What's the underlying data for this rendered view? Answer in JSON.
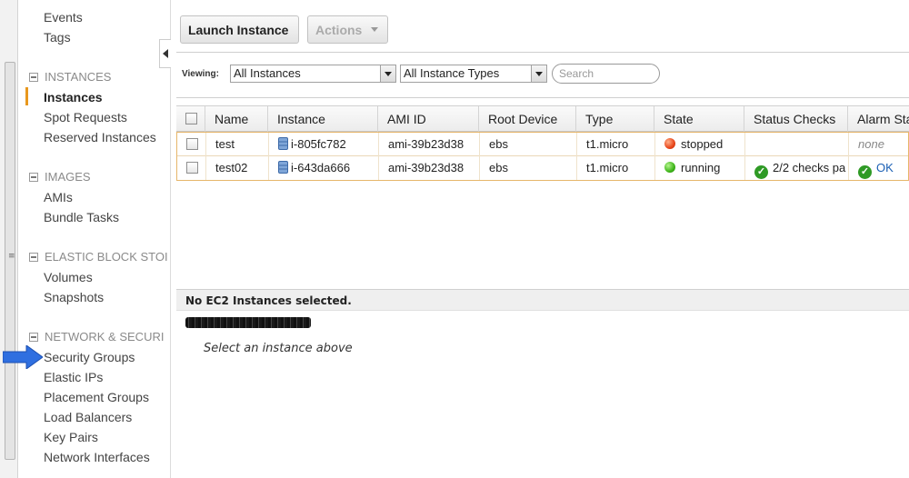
{
  "sidebar": {
    "top_items": [
      "Events",
      "Tags"
    ],
    "sections": [
      {
        "title": "INSTANCES",
        "items": [
          "Instances",
          "Spot Requests",
          "Reserved Instances"
        ]
      },
      {
        "title": "IMAGES",
        "items": [
          "AMIs",
          "Bundle Tasks"
        ]
      },
      {
        "title": "ELASTIC BLOCK STOI",
        "items": [
          "Volumes",
          "Snapshots"
        ]
      },
      {
        "title": "NETWORK & SECURI",
        "items": [
          "Security Groups",
          "Elastic IPs",
          "Placement Groups",
          "Load Balancers",
          "Key Pairs",
          "Network Interfaces"
        ]
      }
    ],
    "active_item": "Instances"
  },
  "toolbar": {
    "launch_label": "Launch Instance",
    "actions_label": "Actions"
  },
  "filters": {
    "viewing_label": "Viewing:",
    "instances_filter": "All Instances",
    "types_filter": "All Instance Types",
    "search_placeholder": "Search"
  },
  "table": {
    "headers": [
      "Name",
      "Instance",
      "AMI ID",
      "Root Device",
      "Type",
      "State",
      "Status Checks",
      "Alarm Sta"
    ],
    "rows": [
      {
        "name": "test",
        "instance": "i-805fc782",
        "ami": "ami-39b23d38",
        "root": "ebs",
        "type": "t1.micro",
        "state": "stopped",
        "status_checks": "",
        "alarm": "none"
      },
      {
        "name": "test02",
        "instance": "i-643da666",
        "ami": "ami-39b23d38",
        "root": "ebs",
        "type": "t1.micro",
        "state": "running",
        "status_checks": "2/2 checks pa",
        "alarm": "OK"
      }
    ]
  },
  "detail": {
    "header": "No EC2 Instances selected.",
    "message": "Select an instance above"
  },
  "colors": {
    "active_accent": "#e8981e",
    "stopped": "#e8461b",
    "running": "#3eb51a",
    "arrow": "#2f6fe0",
    "link": "#1a5fb4"
  }
}
